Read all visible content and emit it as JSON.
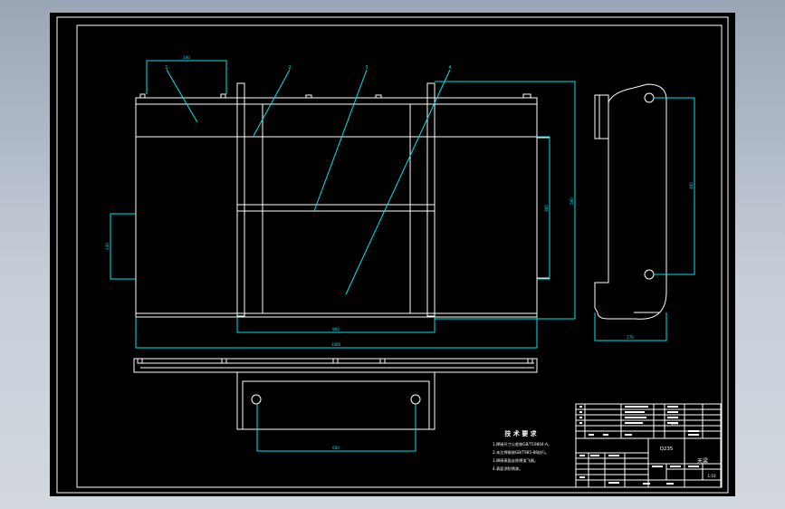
{
  "drawing": {
    "balloons": [
      "1",
      "2",
      "3",
      "4"
    ],
    "dimensions": {
      "top_gap": "240",
      "left_height": "240",
      "inner_height": "360",
      "outer_height": "580",
      "bottom_inner": "860",
      "bottom_overall": "1000",
      "hole_spacing": "600",
      "side_width": "270",
      "side_height": "460"
    },
    "notes": {
      "title": "技 术 要 求",
      "lines": [
        "1.焊接尺寸公差按GB/T19804-A。",
        "2.未注焊接按GB/T985-88执行。",
        "3.焊接表面去除焊渣飞溅。",
        "4.表面涂防锈漆。"
      ]
    }
  },
  "title_block": {
    "drawing_name": "天梁",
    "material": "Q235",
    "scale": "1:10",
    "parts_list_material": "Q235"
  }
}
